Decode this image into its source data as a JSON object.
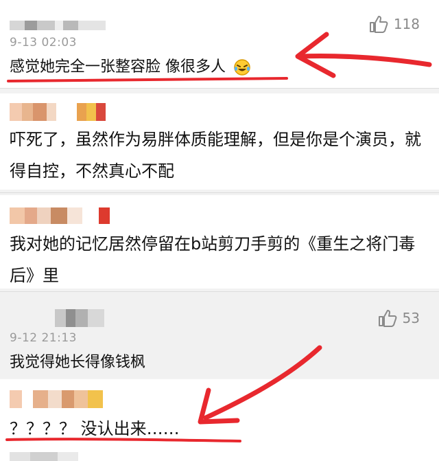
{
  "colors": {
    "annotation": "#e8282e",
    "like_icon": "#8a8a8a"
  },
  "comments": [
    {
      "time": "9-13 02:03",
      "text": "感觉她完全一张整容脸 像很多人",
      "emoji": "laughing-crying-emoji",
      "likes": "118"
    },
    {
      "text": "吓死了，虽然作为易胖体质能理解，但是你是个演员，就得自控，不然真心不配"
    },
    {
      "text": "我对她的记忆居然停留在b站剪刀手剪的《重生之将门毒后》里"
    },
    {
      "time": "9-12 21:13",
      "text": "我觉得她长得像钱枫",
      "likes": "53"
    },
    {
      "text": "？？？？ 没认出来……"
    }
  ]
}
